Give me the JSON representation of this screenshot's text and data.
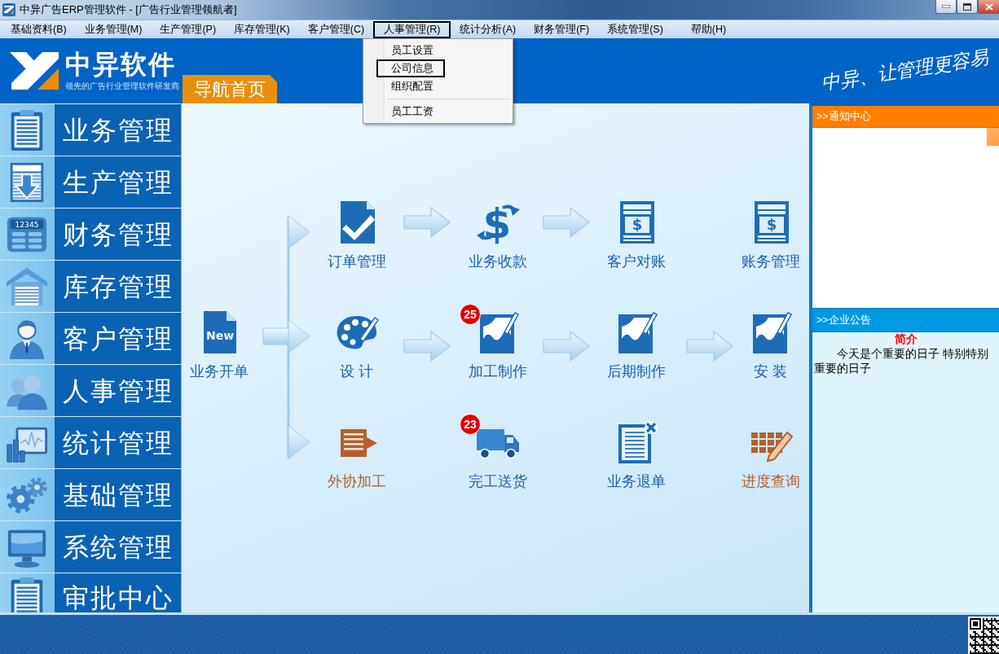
{
  "window": {
    "title": "中异广告ERP管理软件 - [广告行业管理领航者]"
  },
  "menu_bar": [
    {
      "label": "基础资料(B)",
      "selected": false
    },
    {
      "label": "业务管理(M)",
      "selected": false
    },
    {
      "label": "生产管理(P)",
      "selected": false
    },
    {
      "label": "库存管理(K)",
      "selected": false
    },
    {
      "label": "客户管理(C)",
      "selected": false
    },
    {
      "label": "人事管理(R)",
      "selected": true
    },
    {
      "label": "统计分析(A)",
      "selected": false
    },
    {
      "label": "财务管理(F)",
      "selected": false
    },
    {
      "label": "系统管理(S)",
      "selected": false
    },
    {
      "label": "帮助(H)",
      "selected": false
    }
  ],
  "dropdown_menu": [
    {
      "kind": "item",
      "label": "员工设置",
      "selected": false
    },
    {
      "kind": "item",
      "label": "公司信息",
      "selected": true
    },
    {
      "kind": "item",
      "label": "组织配置",
      "selected": false
    },
    {
      "kind": "separator"
    },
    {
      "kind": "item",
      "label": "员工工资",
      "selected": false
    }
  ],
  "header": {
    "brand": "中异软件",
    "tagline": "领先的广告行业管理软件研发商",
    "nav_tab": "导航首页",
    "slogan": "中异、让管理更容易"
  },
  "sidebar": {
    "items": [
      {
        "label": "业务管理"
      },
      {
        "label": "生产管理"
      },
      {
        "label": "财务管理",
        "icon_text": "12345"
      },
      {
        "label": "库存管理"
      },
      {
        "label": "客户管理"
      },
      {
        "label": "人事管理"
      },
      {
        "label": "统计管理"
      },
      {
        "label": "基础管理"
      },
      {
        "label": "系统管理"
      },
      {
        "label": "审批中心"
      }
    ]
  },
  "flow": {
    "start": {
      "label": "业务开单",
      "icon_text": "New",
      "color": "#1d62ad"
    },
    "rows": [
      [
        {
          "label": "订单管理",
          "color": "#1d62ad",
          "arrow": true
        },
        {
          "label": "业务收款",
          "icon_text": "$",
          "color": "#1d62ad",
          "arrow": true
        },
        {
          "label": "客户对账",
          "icon_text": "$",
          "color": "#1d62ad",
          "arrow": false
        },
        {
          "label": "账务管理",
          "icon_text": "$",
          "color": "#1d62ad",
          "arrow": false
        }
      ],
      [
        {
          "label": "设 计",
          "color": "#1d62ad",
          "arrow": true
        },
        {
          "label": "加工制作",
          "badge": "25",
          "color": "#1d62ad",
          "arrow": true
        },
        {
          "label": "后期制作",
          "color": "#1d62ad",
          "arrow": true
        },
        {
          "label": "安 装",
          "color": "#1d62ad",
          "arrow": false
        }
      ],
      [
        {
          "label": "外协加工",
          "color": "#b5602c",
          "arrow": false
        },
        {
          "label": "完工送货",
          "badge": "23",
          "color": "#1d62ad",
          "arrow": false
        },
        {
          "label": "业务退单",
          "color": "#1d62ad",
          "arrow": false
        },
        {
          "label": "进度查询",
          "color": "#b5602c",
          "arrow": false
        }
      ]
    ]
  },
  "notice_panel": {
    "title": ">>通知中心"
  },
  "announcement_panel": {
    "title": ">>企业公告",
    "heading": "简介",
    "body": "今天是个重要的日子 特别特别重要的日子"
  }
}
